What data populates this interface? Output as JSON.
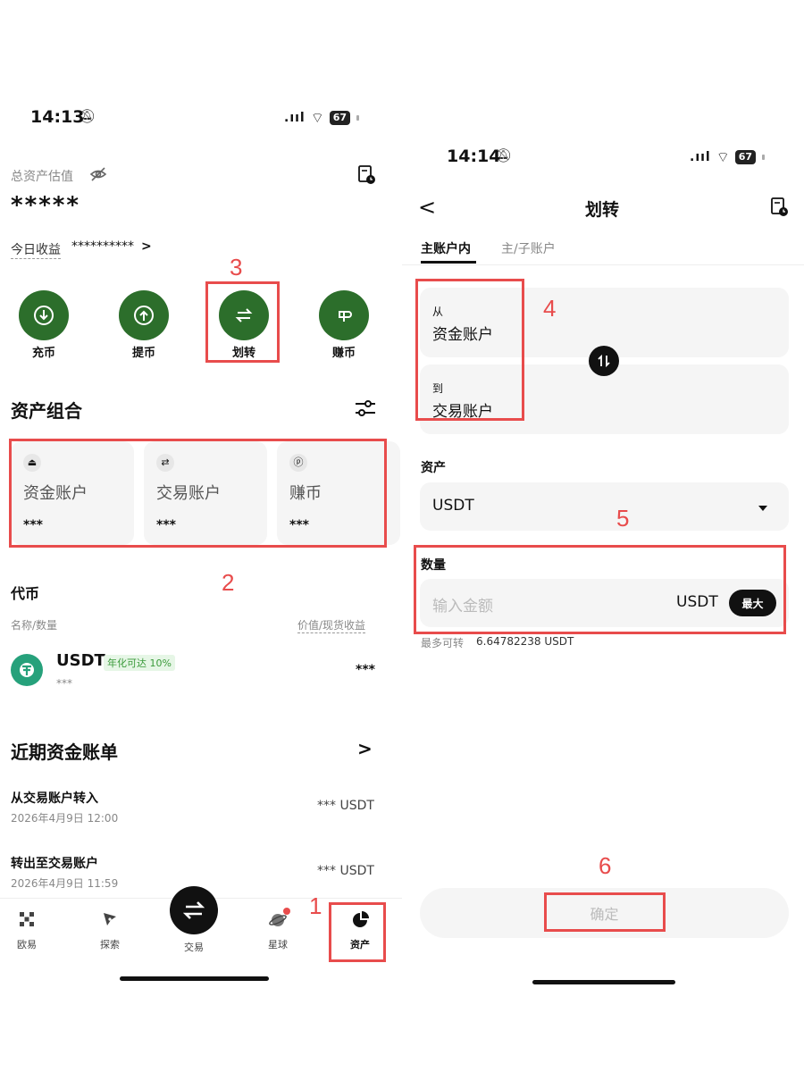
{
  "left": {
    "status": {
      "time": "14:13",
      "battery": "67"
    },
    "total_assets_label": "总资产估值",
    "total_assets_value": "*****",
    "today_income_label": "今日收益",
    "today_income_value": "**********",
    "today_income_chevron": ">",
    "actions": [
      {
        "label": "充币",
        "icon": "deposit-icon"
      },
      {
        "label": "提币",
        "icon": "withdraw-icon"
      },
      {
        "label": "划转",
        "icon": "transfer-icon"
      },
      {
        "label": "赚币",
        "icon": "earn-icon"
      }
    ],
    "portfolio_title": "资产组合",
    "accounts": [
      {
        "name": "资金账户",
        "value": "***",
        "icon": "wallet-icon",
        "glyph": "ⓑ"
      },
      {
        "name": "交易账户",
        "value": "***",
        "icon": "swap-icon",
        "glyph": "⇄"
      },
      {
        "name": "赚币",
        "value": "***",
        "icon": "earn-icon",
        "glyph": "ⓟ"
      }
    ],
    "tokens_title": "代币",
    "col_name_qty": "名称/数量",
    "col_value_pnl": "价值/现货收益",
    "token": {
      "symbol": "USDT",
      "badge": "年化可达 10%",
      "qty": "***",
      "value": "***"
    },
    "recent_title": "近期资金账单",
    "recent_chevron": ">",
    "bills": [
      {
        "title": "从交易账户转入",
        "time": "2026年4月9日 12:00",
        "amount": "*** USDT"
      },
      {
        "title": "转出至交易账户",
        "time": "2026年4月9日 11:59",
        "amount": "*** USDT"
      }
    ],
    "nav": [
      {
        "label": "欧易",
        "icon": "okx-icon"
      },
      {
        "label": "探索",
        "icon": "compass-icon"
      },
      {
        "label": "交易",
        "icon": "trade-icon"
      },
      {
        "label": "星球",
        "icon": "planet-icon"
      },
      {
        "label": "资产",
        "icon": "assets-icon"
      }
    ],
    "annotations": {
      "n1": "1",
      "n2": "2",
      "n3": "3"
    }
  },
  "right": {
    "status": {
      "time": "14:14",
      "battery": "67"
    },
    "back": "<",
    "title": "划转",
    "tabs": [
      {
        "label": "主账户内",
        "active": true
      },
      {
        "label": "主/子账户",
        "active": false
      }
    ],
    "from_label": "从",
    "from_value": "资金账户",
    "to_label": "到",
    "to_value": "交易账户",
    "asset_label": "资产",
    "asset_value": "USDT",
    "amount_label": "数量",
    "amount_placeholder": "输入金额",
    "amount_unit": "USDT",
    "max_label": "最大",
    "available_label": "最多可转",
    "available_value": "6.64782238 USDT",
    "confirm": "确定",
    "annotations": {
      "n4": "4",
      "n5": "5",
      "n6": "6"
    }
  },
  "colors": {
    "accent_green": "#2c6e2b",
    "annotation_red": "#e84c4c"
  }
}
